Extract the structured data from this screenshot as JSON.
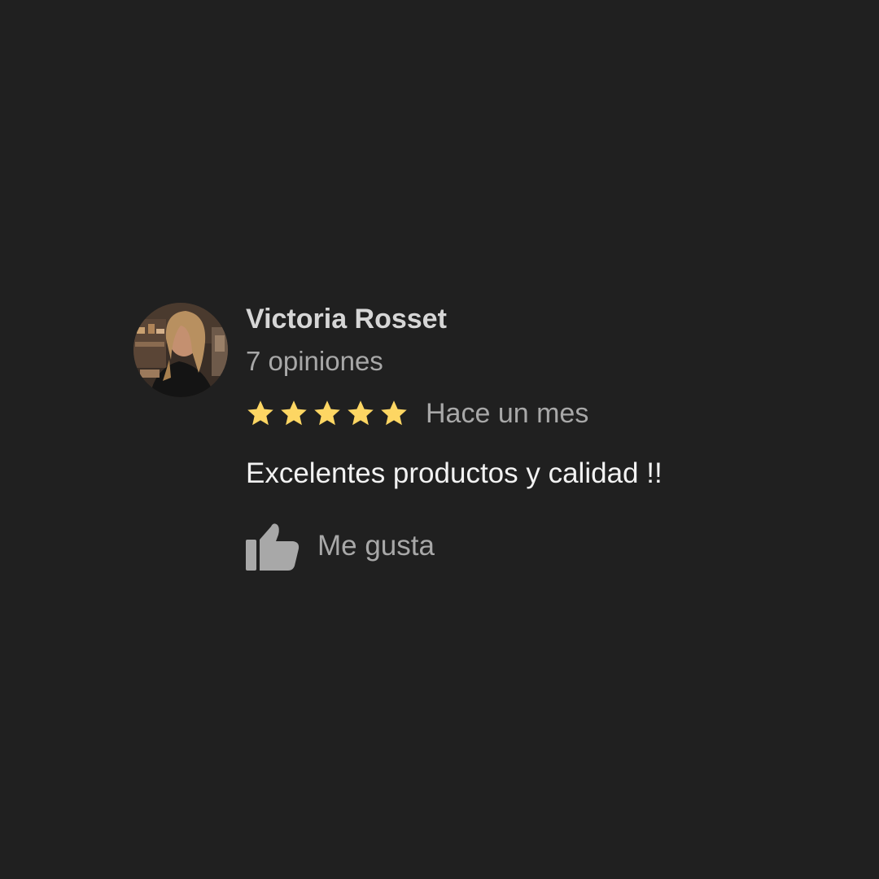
{
  "review": {
    "author_name": "Victoria Rosset",
    "review_count": "7 opiniones",
    "rating": 5,
    "rating_max": 5,
    "time_ago": "Hace un mes",
    "text": "Excelentes productos y calidad !!",
    "like_label": "Me gusta"
  },
  "icons": {
    "star": "star-icon",
    "like": "thumbs-up-icon"
  },
  "colors": {
    "background": "#202020",
    "star": "#fdd663",
    "name": "#d6d6d6",
    "secondary_text": "#a8a8a8",
    "body_text": "#f2f2f2"
  }
}
